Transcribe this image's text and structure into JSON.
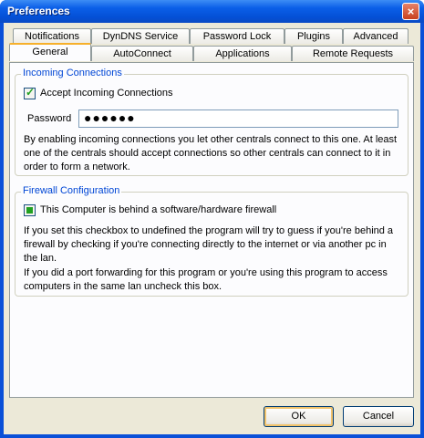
{
  "window": {
    "title": "Preferences",
    "close_label": "×"
  },
  "tabs": {
    "row_back": [
      "Notifications",
      "DynDNS Service",
      "Password Lock",
      "Plugins",
      "Advanced"
    ],
    "row_front": [
      "General",
      "AutoConnect",
      "Applications",
      "Remote Requests"
    ],
    "active": "General"
  },
  "incoming": {
    "legend": "Incoming Connections",
    "checkbox_label": "Accept Incoming Connections",
    "checked": true,
    "password_label": "Password",
    "password_value": "●●●●●●",
    "description": "By enabling incoming connections you let other centrals connect to this one. At least one of the centrals should accept connections so other centrals can connect to it in order to form a network."
  },
  "firewall": {
    "legend": "Firewall Configuration",
    "checkbox_label": "This Computer is behind a software/hardware firewall",
    "checked": "indeterminate",
    "para1": "If you set this checkbox to undefined the program will try to guess if you're behind a firewall by checking if you're connecting directly to the internet or via another pc in the lan.",
    "para2": "If you did a port forwarding for this program or you're using this program to access computers in the same lan uncheck this box."
  },
  "buttons": {
    "ok": "OK",
    "cancel": "Cancel"
  }
}
